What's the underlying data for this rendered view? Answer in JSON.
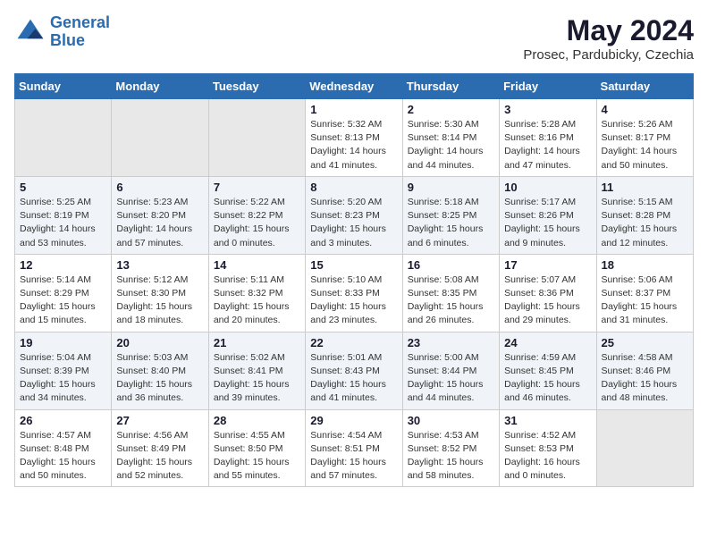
{
  "header": {
    "logo_line1": "General",
    "logo_line2": "Blue",
    "month_title": "May 2024",
    "location": "Prosec, Pardubicky, Czechia"
  },
  "weekdays": [
    "Sunday",
    "Monday",
    "Tuesday",
    "Wednesday",
    "Thursday",
    "Friday",
    "Saturday"
  ],
  "weeks": [
    [
      {
        "day": "",
        "info": ""
      },
      {
        "day": "",
        "info": ""
      },
      {
        "day": "",
        "info": ""
      },
      {
        "day": "1",
        "info": "Sunrise: 5:32 AM\nSunset: 8:13 PM\nDaylight: 14 hours\nand 41 minutes."
      },
      {
        "day": "2",
        "info": "Sunrise: 5:30 AM\nSunset: 8:14 PM\nDaylight: 14 hours\nand 44 minutes."
      },
      {
        "day": "3",
        "info": "Sunrise: 5:28 AM\nSunset: 8:16 PM\nDaylight: 14 hours\nand 47 minutes."
      },
      {
        "day": "4",
        "info": "Sunrise: 5:26 AM\nSunset: 8:17 PM\nDaylight: 14 hours\nand 50 minutes."
      }
    ],
    [
      {
        "day": "5",
        "info": "Sunrise: 5:25 AM\nSunset: 8:19 PM\nDaylight: 14 hours\nand 53 minutes."
      },
      {
        "day": "6",
        "info": "Sunrise: 5:23 AM\nSunset: 8:20 PM\nDaylight: 14 hours\nand 57 minutes."
      },
      {
        "day": "7",
        "info": "Sunrise: 5:22 AM\nSunset: 8:22 PM\nDaylight: 15 hours\nand 0 minutes."
      },
      {
        "day": "8",
        "info": "Sunrise: 5:20 AM\nSunset: 8:23 PM\nDaylight: 15 hours\nand 3 minutes."
      },
      {
        "day": "9",
        "info": "Sunrise: 5:18 AM\nSunset: 8:25 PM\nDaylight: 15 hours\nand 6 minutes."
      },
      {
        "day": "10",
        "info": "Sunrise: 5:17 AM\nSunset: 8:26 PM\nDaylight: 15 hours\nand 9 minutes."
      },
      {
        "day": "11",
        "info": "Sunrise: 5:15 AM\nSunset: 8:28 PM\nDaylight: 15 hours\nand 12 minutes."
      }
    ],
    [
      {
        "day": "12",
        "info": "Sunrise: 5:14 AM\nSunset: 8:29 PM\nDaylight: 15 hours\nand 15 minutes."
      },
      {
        "day": "13",
        "info": "Sunrise: 5:12 AM\nSunset: 8:30 PM\nDaylight: 15 hours\nand 18 minutes."
      },
      {
        "day": "14",
        "info": "Sunrise: 5:11 AM\nSunset: 8:32 PM\nDaylight: 15 hours\nand 20 minutes."
      },
      {
        "day": "15",
        "info": "Sunrise: 5:10 AM\nSunset: 8:33 PM\nDaylight: 15 hours\nand 23 minutes."
      },
      {
        "day": "16",
        "info": "Sunrise: 5:08 AM\nSunset: 8:35 PM\nDaylight: 15 hours\nand 26 minutes."
      },
      {
        "day": "17",
        "info": "Sunrise: 5:07 AM\nSunset: 8:36 PM\nDaylight: 15 hours\nand 29 minutes."
      },
      {
        "day": "18",
        "info": "Sunrise: 5:06 AM\nSunset: 8:37 PM\nDaylight: 15 hours\nand 31 minutes."
      }
    ],
    [
      {
        "day": "19",
        "info": "Sunrise: 5:04 AM\nSunset: 8:39 PM\nDaylight: 15 hours\nand 34 minutes."
      },
      {
        "day": "20",
        "info": "Sunrise: 5:03 AM\nSunset: 8:40 PM\nDaylight: 15 hours\nand 36 minutes."
      },
      {
        "day": "21",
        "info": "Sunrise: 5:02 AM\nSunset: 8:41 PM\nDaylight: 15 hours\nand 39 minutes."
      },
      {
        "day": "22",
        "info": "Sunrise: 5:01 AM\nSunset: 8:43 PM\nDaylight: 15 hours\nand 41 minutes."
      },
      {
        "day": "23",
        "info": "Sunrise: 5:00 AM\nSunset: 8:44 PM\nDaylight: 15 hours\nand 44 minutes."
      },
      {
        "day": "24",
        "info": "Sunrise: 4:59 AM\nSunset: 8:45 PM\nDaylight: 15 hours\nand 46 minutes."
      },
      {
        "day": "25",
        "info": "Sunrise: 4:58 AM\nSunset: 8:46 PM\nDaylight: 15 hours\nand 48 minutes."
      }
    ],
    [
      {
        "day": "26",
        "info": "Sunrise: 4:57 AM\nSunset: 8:48 PM\nDaylight: 15 hours\nand 50 minutes."
      },
      {
        "day": "27",
        "info": "Sunrise: 4:56 AM\nSunset: 8:49 PM\nDaylight: 15 hours\nand 52 minutes."
      },
      {
        "day": "28",
        "info": "Sunrise: 4:55 AM\nSunset: 8:50 PM\nDaylight: 15 hours\nand 55 minutes."
      },
      {
        "day": "29",
        "info": "Sunrise: 4:54 AM\nSunset: 8:51 PM\nDaylight: 15 hours\nand 57 minutes."
      },
      {
        "day": "30",
        "info": "Sunrise: 4:53 AM\nSunset: 8:52 PM\nDaylight: 15 hours\nand 58 minutes."
      },
      {
        "day": "31",
        "info": "Sunrise: 4:52 AM\nSunset: 8:53 PM\nDaylight: 16 hours\nand 0 minutes."
      },
      {
        "day": "",
        "info": ""
      }
    ]
  ]
}
